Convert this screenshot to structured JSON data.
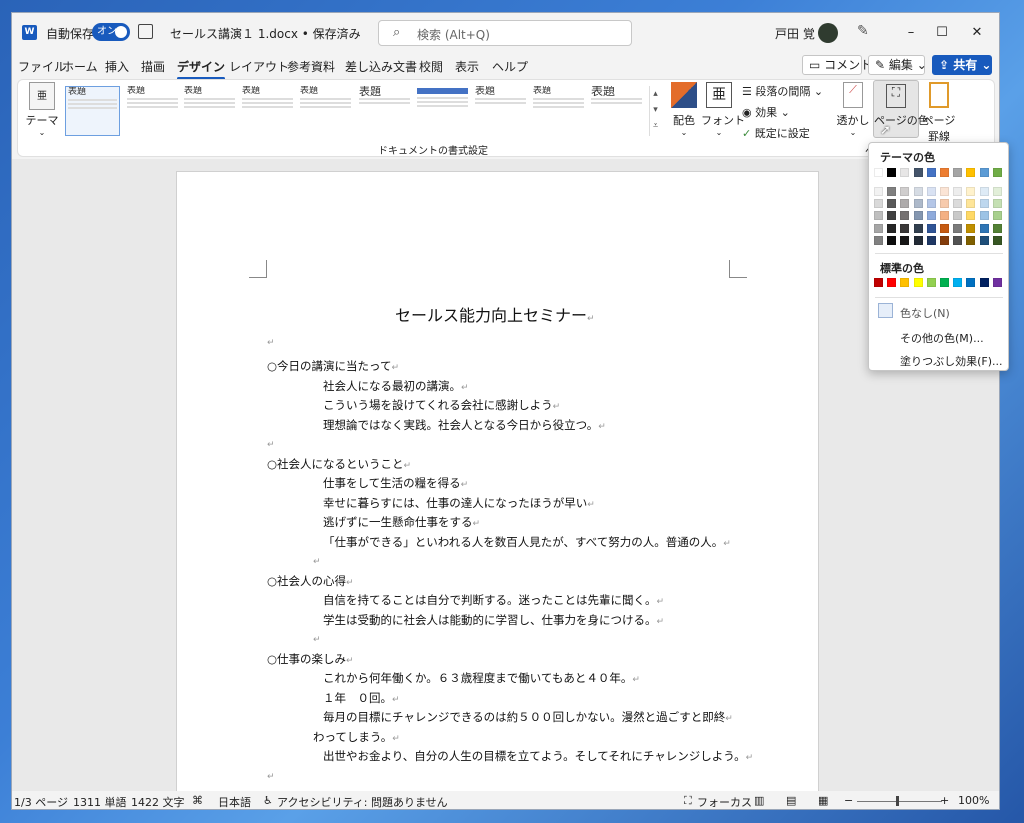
{
  "titlebar": {
    "autosave_label": "自動保存",
    "autosave_state": "オン",
    "doc_title": "セールス講演１ 1.docx • 保存済み",
    "search_placeholder": "検索 (Alt+Q)",
    "user_name": "戸田 覚"
  },
  "menu": {
    "tabs": [
      "ファイル",
      "ホーム",
      "挿入",
      "描画",
      "デザイン",
      "レイアウト",
      "参考資料",
      "差し込み文書",
      "校閲",
      "表示",
      "ヘルプ"
    ],
    "active": "デザイン",
    "comment": "コメント",
    "edit": "編集",
    "share": "共有"
  },
  "ribbon": {
    "theme": "テーマ",
    "gallery_label": "ドキュメントの書式設定",
    "gallery_items": [
      "表題",
      "表題",
      "表題",
      "表題",
      "表題",
      "表題",
      "表題",
      "表題",
      "表題",
      "表題",
      "表題",
      "表題"
    ],
    "colors": "配色",
    "fonts": "フォント",
    "para_spacing": "段落の間隔",
    "effects": "効果",
    "set_default": "既定に設定",
    "watermark": "透かし",
    "page_color": "ページの色",
    "page_borders_1": "ページ",
    "page_borders_2": "罫線",
    "bg_group": "ペ"
  },
  "document": {
    "title": "セールス能力向上セミナー",
    "lines": [
      {
        "t": "○今日の講演に当たって",
        "ind": 0
      },
      {
        "t": "社会人になる最初の講演。",
        "ind": 1
      },
      {
        "t": "こういう場を設けてくれる会社に感謝しよう",
        "ind": 1
      },
      {
        "t": "理想論ではなく実践。社会人となる今日から役立つ。",
        "ind": 1
      },
      {
        "t": "",
        "ind": 0
      },
      {
        "t": "○社会人になるということ",
        "ind": 0
      },
      {
        "t": "仕事をして生活の糧を得る",
        "ind": 1
      },
      {
        "t": "幸せに暮らすには、仕事の達人になったほうが早い",
        "ind": 1
      },
      {
        "t": "逃げずに一生懸命仕事をする",
        "ind": 1
      },
      {
        "t": "「仕事ができる」といわれる人を数百人見たが、すべて努力の人。普通の人。",
        "ind": 1
      },
      {
        "t": "",
        "ind": 2
      },
      {
        "t": "○社会人の心得",
        "ind": 0
      },
      {
        "t": "自信を持てることは自分で判断する。迷ったことは先輩に聞く。",
        "ind": 1
      },
      {
        "t": "学生は受動的に社会人は能動的に学習し、仕事力を身につける。",
        "ind": 1
      },
      {
        "t": "",
        "ind": 2
      },
      {
        "t": "○仕事の楽しみ",
        "ind": 0
      },
      {
        "t": "これから何年働くか。６３歳程度まで働いてもあと４０年。",
        "ind": 1
      },
      {
        "t": "１年　０回。",
        "ind": 1
      },
      {
        "t": "毎月の目標にチャレンジできるのは約５００回しかない。漫然と過ごすと即終",
        "ind": 1
      },
      {
        "t": "わってしまう。",
        "ind": 2
      },
      {
        "t": "出世やお金より、自分の人生の目標を立てよう。そしてそれにチャレンジしよう。",
        "ind": 1
      },
      {
        "t": "",
        "ind": 0
      }
    ]
  },
  "status": {
    "page": "1/3 ページ",
    "words": "1311 単語",
    "chars": "1422 文字",
    "lang": "日本語",
    "accessibility": "アクセシビリティ: 問題ありません",
    "focus": "フォーカス",
    "zoom": "100%"
  },
  "popup": {
    "theme_colors": "テーマの色",
    "standard_colors": "標準の色",
    "no_color": "色なし(N)",
    "more_colors": "その他の色(M)...",
    "fill_effects": "塗りつぶし効果(F)...",
    "theme_top": [
      "#ffffff",
      "#000000",
      "#e7e6e6",
      "#44546a",
      "#4472c4",
      "#ed7d31",
      "#a5a5a5",
      "#ffc000",
      "#5b9bd5",
      "#70ad47"
    ],
    "theme_shades": [
      [
        "#f2f2f2",
        "#d9d9d9",
        "#bfbfbf",
        "#a6a6a6",
        "#808080"
      ],
      [
        "#7f7f7f",
        "#595959",
        "#404040",
        "#262626",
        "#0d0d0d"
      ],
      [
        "#d0cece",
        "#aeabab",
        "#757171",
        "#3a3838",
        "#171616"
      ],
      [
        "#d6dce4",
        "#adb9ca",
        "#8496b0",
        "#323f4f",
        "#222a35"
      ],
      [
        "#d9e2f3",
        "#b4c6e7",
        "#8eaadb",
        "#2f5496",
        "#1f3864"
      ],
      [
        "#fbe4d5",
        "#f7caac",
        "#f4b083",
        "#c55a11",
        "#833c0b"
      ],
      [
        "#ededed",
        "#dbdbdb",
        "#c9c9c9",
        "#7b7b7b",
        "#525252"
      ],
      [
        "#fff2cc",
        "#fee599",
        "#ffd965",
        "#bf8f00",
        "#7f6000"
      ],
      [
        "#deebf6",
        "#bdd7ee",
        "#9cc3e5",
        "#2e75b5",
        "#1e4e79"
      ],
      [
        "#e2efd9",
        "#c5e0b3",
        "#a8d08d",
        "#538135",
        "#375623"
      ]
    ],
    "standard": [
      "#c00000",
      "#ff0000",
      "#ffc000",
      "#ffff00",
      "#92d050",
      "#00b050",
      "#00b0f0",
      "#0070c0",
      "#002060",
      "#7030a0"
    ]
  }
}
